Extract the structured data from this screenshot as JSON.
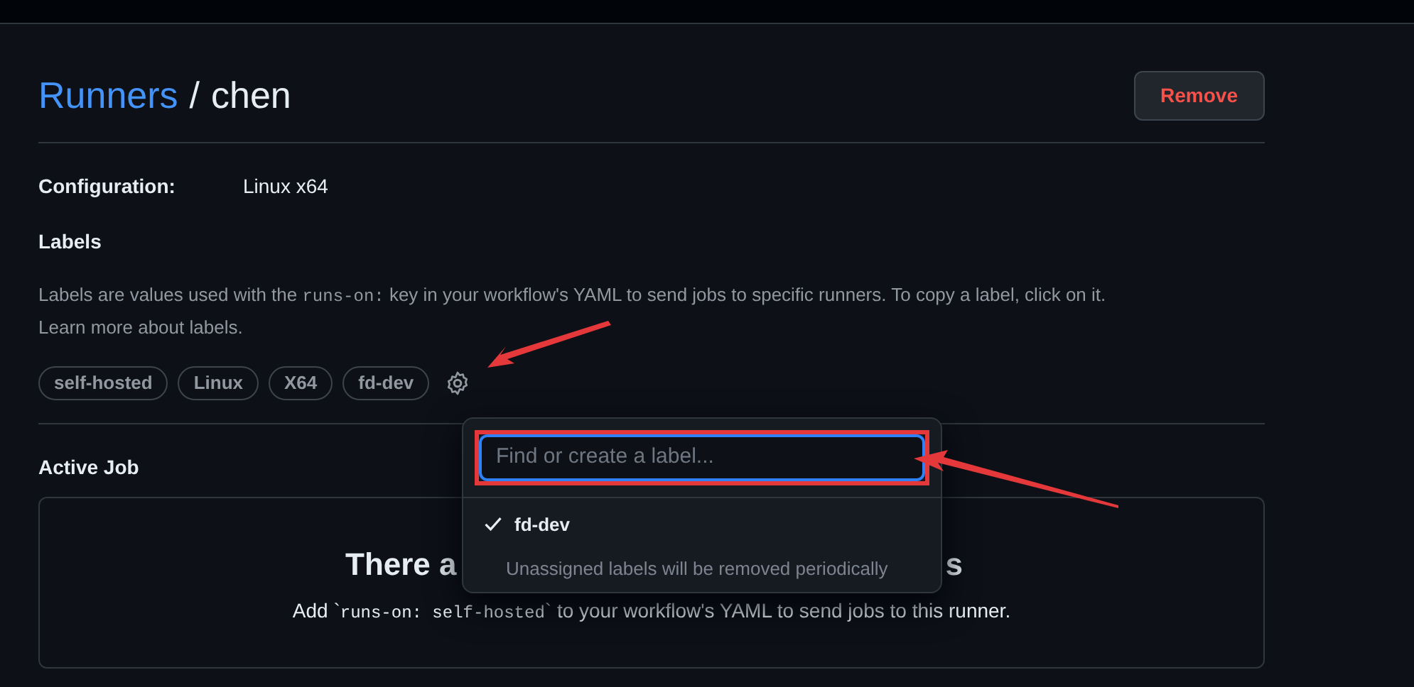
{
  "breadcrumb": {
    "link": "Runners",
    "separator": "/",
    "current": "chen"
  },
  "remove_button": "Remove",
  "configuration": {
    "label": "Configuration:",
    "value": "Linux x64"
  },
  "labels_section": {
    "title": "Labels",
    "description": {
      "before": "Labels are values used with the",
      "code": "runs-on:",
      "after": "key in your workflow's YAML to send jobs to specific runners. To copy a label, click on it.",
      "link": "Learn more about labels."
    },
    "labels": [
      "self-hosted",
      "Linux",
      "X64",
      "fd-dev"
    ]
  },
  "label_menu": {
    "search": {
      "placeholder": "Find or create a label..."
    },
    "options": [
      {
        "label": "fd-dev",
        "checked": true
      }
    ],
    "note": "Unassigned labels will be removed periodically"
  },
  "active_job": {
    "title": "Active Job",
    "heading_visible_parts": [
      "There a",
      "s"
    ],
    "hint": {
      "before": "Add `",
      "code": "runs-on: self-hosted",
      "after": "` to your workflow's YAML to send jobs to this runner."
    }
  }
}
